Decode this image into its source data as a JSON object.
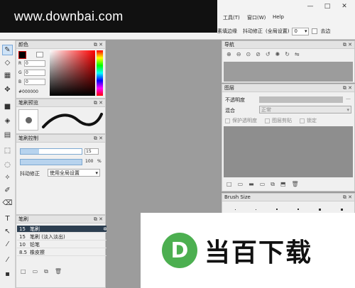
{
  "watermark": {
    "text": "www.downbai.com"
  },
  "menu": {
    "tools": "工具(T)",
    "window": "窗口(W)",
    "help": "Help"
  },
  "window": {
    "minimize": "—",
    "maximize": "□",
    "close": "✕"
  },
  "toolbar": {
    "partial": "素填边缘",
    "stabilizer_label": "抖动修正",
    "stabilizer_value": "(全局设置)",
    "stabilizer_num": "0",
    "checkbox_label": "去边"
  },
  "color_panel": {
    "title": "颜色",
    "r_label": "R",
    "r_value": "0",
    "g_label": "G",
    "g_value": "0",
    "b_label": "B",
    "b_value": "0",
    "hex": "#000000",
    "primary": "#000000",
    "secondary": "#ffffff"
  },
  "brush_preview": {
    "title": "笔刷预览"
  },
  "brush_control": {
    "title": "笔刷控制",
    "size_value": "15",
    "opacity_value": "100",
    "opacity_unit": "%",
    "stabilizer_label": "抖动修正",
    "stabilizer_option": "使用全局设置"
  },
  "brush_list": {
    "title": "笔刷",
    "items": [
      {
        "size": "15",
        "name": "笔刷"
      },
      {
        "size": "15",
        "name": "笔刷 (淡入淡出)"
      },
      {
        "size": "10",
        "name": "铅笔"
      },
      {
        "size": "8.5",
        "name": "橡皮擦"
      }
    ]
  },
  "navigator": {
    "title": "导航"
  },
  "layers": {
    "title": "图层",
    "opacity_label": "不透明度",
    "blend_label": "混合",
    "blend_value": "正常",
    "protect_alpha": "保护透明度",
    "clip": "图层剪贴",
    "lock": "锁定"
  },
  "brush_size": {
    "title": "Brush Size"
  },
  "promo": {
    "logo_letter": "D",
    "text": "当百下载"
  }
}
